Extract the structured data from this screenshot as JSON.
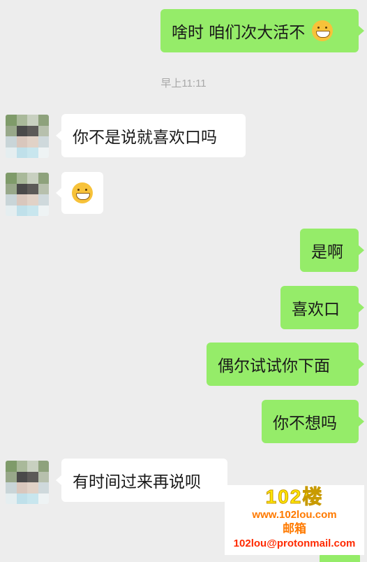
{
  "messages": [
    {
      "side": "sent",
      "text": "啥时 咱们次大活不",
      "emoji": "grin-emoji"
    },
    {
      "side": "time",
      "text": "早上11:11"
    },
    {
      "side": "recv",
      "text": "你不是说就喜欢口吗"
    },
    {
      "side": "recv",
      "text": "",
      "emoji": "grin-emoji"
    },
    {
      "side": "sent",
      "text": "是啊"
    },
    {
      "side": "sent",
      "text": "喜欢口"
    },
    {
      "side": "sent",
      "text": "偶尔试试你下面"
    },
    {
      "side": "sent",
      "text": "你不想吗"
    },
    {
      "side": "recv",
      "text": "有时间过来再说呗"
    }
  ],
  "watermark": {
    "title": "102楼",
    "site": "www.102lou.com",
    "mail_label": "邮箱",
    "mail": "102lou@protonmail.com"
  },
  "colors": {
    "background": "#ededed",
    "sent_bubble": "#95ec69",
    "recv_bubble": "#ffffff"
  }
}
